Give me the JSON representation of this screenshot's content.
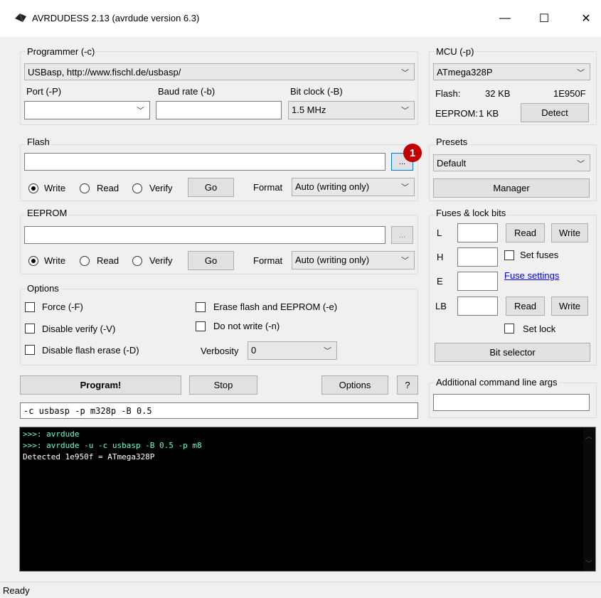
{
  "window": {
    "title": "AVRDUDESS 2.13 (avrdude version 6.3)",
    "minimize": "—",
    "maximize": "☐",
    "close": "✕"
  },
  "programmer": {
    "group_label": "Programmer (-c)",
    "selected": "USBasp, http://www.fischl.de/usbasp/",
    "port_label": "Port (-P)",
    "port_value": "",
    "baud_label": "Baud rate (-b)",
    "baud_value": "",
    "bitclock_label": "Bit clock (-B)",
    "bitclock_value": "1.5 MHz"
  },
  "mcu": {
    "group_label": "MCU (-p)",
    "selected": "ATmega328P",
    "flash_label": "Flash:",
    "flash_size": "32 KB",
    "signature": "1E950F",
    "eeprom_label": "EEPROM:",
    "eeprom_size": "1 KB",
    "detect_button": "Detect"
  },
  "flash": {
    "group_label": "Flash",
    "file": "",
    "browse": "...",
    "write": "Write",
    "read": "Read",
    "verify": "Verify",
    "mode": "write",
    "go": "Go",
    "format_label": "Format",
    "format_value": "Auto (writing only)",
    "badge": "1"
  },
  "eeprom": {
    "group_label": "EEPROM",
    "file": "",
    "browse": "...",
    "write": "Write",
    "read": "Read",
    "verify": "Verify",
    "mode": "write",
    "go": "Go",
    "format_label": "Format",
    "format_value": "Auto (writing only)"
  },
  "presets": {
    "group_label": "Presets",
    "selected": "Default",
    "manager_button": "Manager"
  },
  "fuses": {
    "group_label": "Fuses & lock bits",
    "l_label": "L",
    "h_label": "H",
    "e_label": "E",
    "lb_label": "LB",
    "l_value": "",
    "h_value": "",
    "e_value": "",
    "lb_value": "",
    "read": "Read",
    "write": "Write",
    "set_fuses": "Set fuses",
    "fuse_settings": "Fuse settings",
    "set_lock": "Set lock",
    "bit_selector": "Bit selector"
  },
  "options": {
    "group_label": "Options",
    "force": "Force (-F)",
    "disable_verify": "Disable verify (-V)",
    "disable_flash_erase": "Disable flash erase (-D)",
    "erase_flash_eeprom": "Erase flash and EEPROM (-e)",
    "do_not_write": "Do not write (-n)",
    "verbosity_label": "Verbosity",
    "verbosity_value": "0"
  },
  "actions": {
    "program": "Program!",
    "stop": "Stop",
    "options": "Options",
    "help": "?"
  },
  "cmdline": "-c usbasp -p m328p -B 0.5",
  "additional_args": {
    "label": "Additional command line args",
    "value": ""
  },
  "console": {
    "lines": [
      {
        "text": ">>>: avrdude",
        "color": "#66ffcc"
      },
      {
        "text": ">>>: avrdude -u -c usbasp -B 0.5 -p m8",
        "color": "#66ffcc"
      },
      {
        "text": "Detected 1e950f = ATmega328P",
        "color": "#ffffff"
      }
    ]
  },
  "status": "Ready"
}
